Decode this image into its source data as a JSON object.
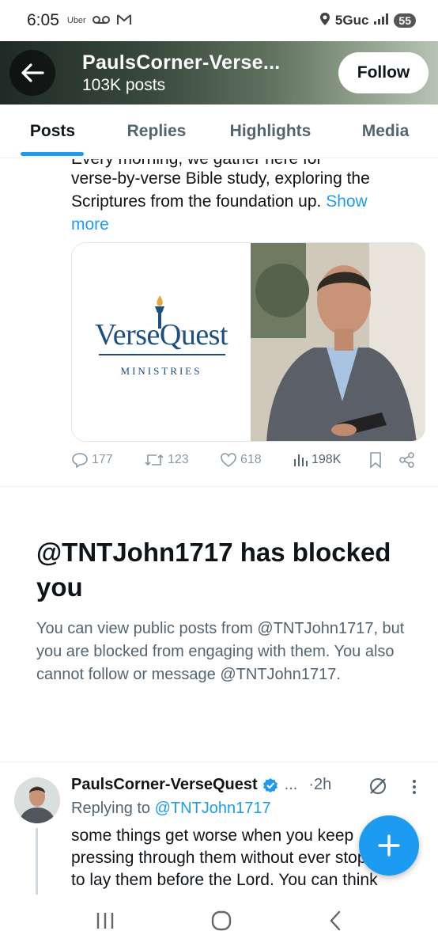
{
  "status_bar": {
    "time": "6:05",
    "left_icons": [
      "uber-icon",
      "voicemail-icon",
      "gmail-icon"
    ],
    "uber_label": "Uber",
    "network": "5Guc",
    "battery": "55"
  },
  "header": {
    "name": "PaulsCorner-Verse...",
    "posts_count": "103K posts",
    "follow_label": "Follow"
  },
  "tabs": [
    {
      "label": "Posts",
      "active": true
    },
    {
      "label": "Replies",
      "active": false
    },
    {
      "label": "Highlights",
      "active": false
    },
    {
      "label": "Media",
      "active": false
    }
  ],
  "post": {
    "cut_line": "Every morning, we gather here for",
    "line1": "verse-by-verse Bible study, exploring the",
    "line2": "Scriptures from the foundation up.",
    "show": "Show",
    "more": "more",
    "media": {
      "logo_main": "VerseQuest",
      "logo_sub": "MINISTRIES"
    },
    "actions": {
      "replies": "177",
      "reposts": "123",
      "likes": "618",
      "views": "198K"
    }
  },
  "blocked": {
    "title": "@TNTJohn1717 has blocked you",
    "text": "You can view public posts from @TNTJohn1717, but you are blocked from engaging with them. You also cannot follow or message @TNTJohn1717."
  },
  "reply": {
    "name": "PaulsCorner-VerseQuest",
    "ellipsis": "...",
    "time": "·2h",
    "replying_prefix": "Replying to",
    "replying_handle": "@TNTJohn1717",
    "text": "some things get worse when you keep pressing through them without ever stopping to lay them before the Lord. You can think"
  },
  "colors": {
    "accent": "#1d9bf0",
    "text_primary": "#0f1419",
    "text_secondary": "#536471"
  }
}
